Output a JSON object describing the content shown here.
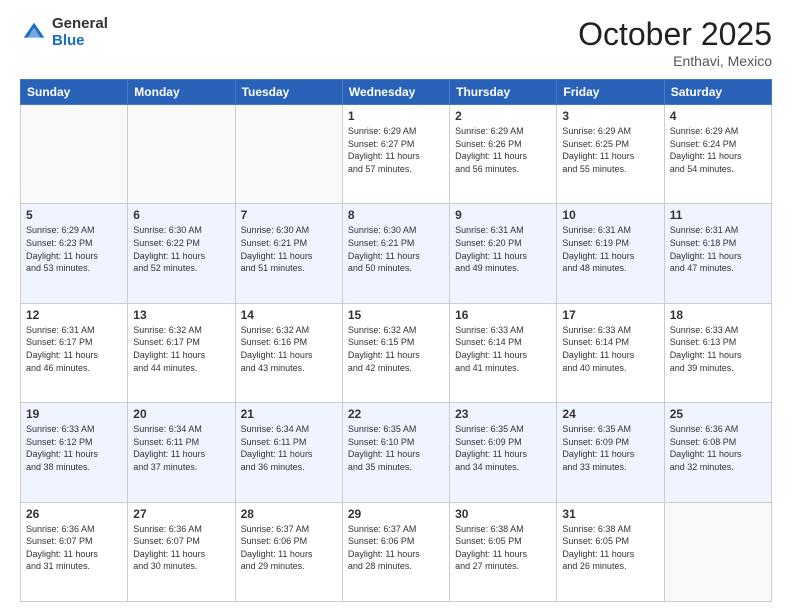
{
  "header": {
    "logo_general": "General",
    "logo_blue": "Blue",
    "month_title": "October 2025",
    "location": "Enthavi, Mexico"
  },
  "days_of_week": [
    "Sunday",
    "Monday",
    "Tuesday",
    "Wednesday",
    "Thursday",
    "Friday",
    "Saturday"
  ],
  "weeks": [
    [
      {
        "day": "",
        "info": ""
      },
      {
        "day": "",
        "info": ""
      },
      {
        "day": "",
        "info": ""
      },
      {
        "day": "1",
        "info": "Sunrise: 6:29 AM\nSunset: 6:27 PM\nDaylight: 11 hours\nand 57 minutes."
      },
      {
        "day": "2",
        "info": "Sunrise: 6:29 AM\nSunset: 6:26 PM\nDaylight: 11 hours\nand 56 minutes."
      },
      {
        "day": "3",
        "info": "Sunrise: 6:29 AM\nSunset: 6:25 PM\nDaylight: 11 hours\nand 55 minutes."
      },
      {
        "day": "4",
        "info": "Sunrise: 6:29 AM\nSunset: 6:24 PM\nDaylight: 11 hours\nand 54 minutes."
      }
    ],
    [
      {
        "day": "5",
        "info": "Sunrise: 6:29 AM\nSunset: 6:23 PM\nDaylight: 11 hours\nand 53 minutes."
      },
      {
        "day": "6",
        "info": "Sunrise: 6:30 AM\nSunset: 6:22 PM\nDaylight: 11 hours\nand 52 minutes."
      },
      {
        "day": "7",
        "info": "Sunrise: 6:30 AM\nSunset: 6:21 PM\nDaylight: 11 hours\nand 51 minutes."
      },
      {
        "day": "8",
        "info": "Sunrise: 6:30 AM\nSunset: 6:21 PM\nDaylight: 11 hours\nand 50 minutes."
      },
      {
        "day": "9",
        "info": "Sunrise: 6:31 AM\nSunset: 6:20 PM\nDaylight: 11 hours\nand 49 minutes."
      },
      {
        "day": "10",
        "info": "Sunrise: 6:31 AM\nSunset: 6:19 PM\nDaylight: 11 hours\nand 48 minutes."
      },
      {
        "day": "11",
        "info": "Sunrise: 6:31 AM\nSunset: 6:18 PM\nDaylight: 11 hours\nand 47 minutes."
      }
    ],
    [
      {
        "day": "12",
        "info": "Sunrise: 6:31 AM\nSunset: 6:17 PM\nDaylight: 11 hours\nand 46 minutes."
      },
      {
        "day": "13",
        "info": "Sunrise: 6:32 AM\nSunset: 6:17 PM\nDaylight: 11 hours\nand 44 minutes."
      },
      {
        "day": "14",
        "info": "Sunrise: 6:32 AM\nSunset: 6:16 PM\nDaylight: 11 hours\nand 43 minutes."
      },
      {
        "day": "15",
        "info": "Sunrise: 6:32 AM\nSunset: 6:15 PM\nDaylight: 11 hours\nand 42 minutes."
      },
      {
        "day": "16",
        "info": "Sunrise: 6:33 AM\nSunset: 6:14 PM\nDaylight: 11 hours\nand 41 minutes."
      },
      {
        "day": "17",
        "info": "Sunrise: 6:33 AM\nSunset: 6:14 PM\nDaylight: 11 hours\nand 40 minutes."
      },
      {
        "day": "18",
        "info": "Sunrise: 6:33 AM\nSunset: 6:13 PM\nDaylight: 11 hours\nand 39 minutes."
      }
    ],
    [
      {
        "day": "19",
        "info": "Sunrise: 6:33 AM\nSunset: 6:12 PM\nDaylight: 11 hours\nand 38 minutes."
      },
      {
        "day": "20",
        "info": "Sunrise: 6:34 AM\nSunset: 6:11 PM\nDaylight: 11 hours\nand 37 minutes."
      },
      {
        "day": "21",
        "info": "Sunrise: 6:34 AM\nSunset: 6:11 PM\nDaylight: 11 hours\nand 36 minutes."
      },
      {
        "day": "22",
        "info": "Sunrise: 6:35 AM\nSunset: 6:10 PM\nDaylight: 11 hours\nand 35 minutes."
      },
      {
        "day": "23",
        "info": "Sunrise: 6:35 AM\nSunset: 6:09 PM\nDaylight: 11 hours\nand 34 minutes."
      },
      {
        "day": "24",
        "info": "Sunrise: 6:35 AM\nSunset: 6:09 PM\nDaylight: 11 hours\nand 33 minutes."
      },
      {
        "day": "25",
        "info": "Sunrise: 6:36 AM\nSunset: 6:08 PM\nDaylight: 11 hours\nand 32 minutes."
      }
    ],
    [
      {
        "day": "26",
        "info": "Sunrise: 6:36 AM\nSunset: 6:07 PM\nDaylight: 11 hours\nand 31 minutes."
      },
      {
        "day": "27",
        "info": "Sunrise: 6:36 AM\nSunset: 6:07 PM\nDaylight: 11 hours\nand 30 minutes."
      },
      {
        "day": "28",
        "info": "Sunrise: 6:37 AM\nSunset: 6:06 PM\nDaylight: 11 hours\nand 29 minutes."
      },
      {
        "day": "29",
        "info": "Sunrise: 6:37 AM\nSunset: 6:06 PM\nDaylight: 11 hours\nand 28 minutes."
      },
      {
        "day": "30",
        "info": "Sunrise: 6:38 AM\nSunset: 6:05 PM\nDaylight: 11 hours\nand 27 minutes."
      },
      {
        "day": "31",
        "info": "Sunrise: 6:38 AM\nSunset: 6:05 PM\nDaylight: 11 hours\nand 26 minutes."
      },
      {
        "day": "",
        "info": ""
      }
    ]
  ]
}
